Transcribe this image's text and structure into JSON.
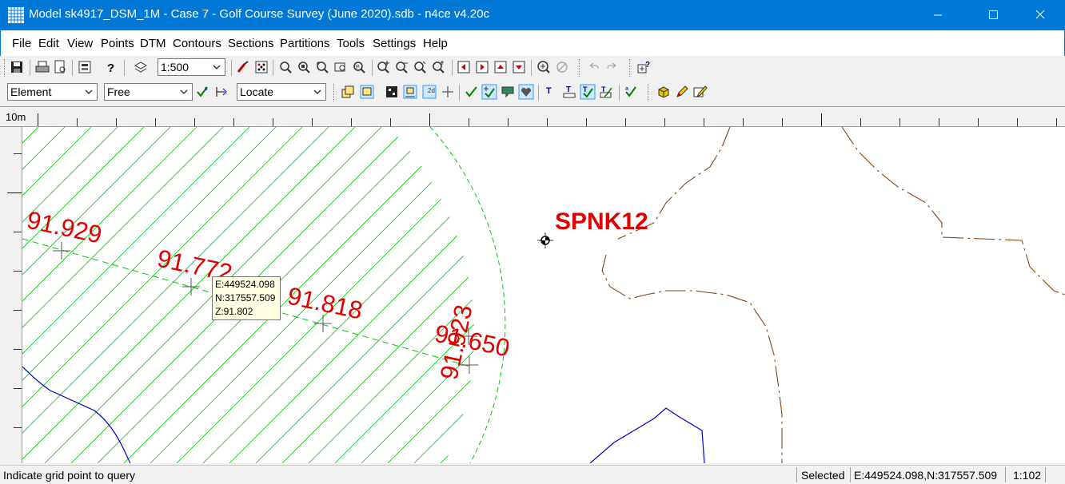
{
  "window": {
    "title": "Model sk4917_DSM_1M - Case 7 - Golf Course Survey (June 2020).sdb - n4ce v4.20c"
  },
  "menu": [
    "File",
    "Edit",
    "View",
    "Points",
    "DTM",
    "Contours",
    "Sections",
    "Partitions",
    "Tools",
    "Settings",
    "Help"
  ],
  "toolbar": {
    "scale": "1:500",
    "select_mode": "Element",
    "snap_mode": "Free",
    "locate_mode": "Locate"
  },
  "ruler": {
    "unit": "10m"
  },
  "canvas": {
    "station_label": "SPNK12",
    "spot_levels": [
      "91.929",
      "91.772",
      "91.818",
      "91.923",
      "91.650"
    ],
    "label_color": "#ff0000",
    "hatch_color": "#00c800",
    "contour_color": "#8b4513",
    "line_color": "#0000c8"
  },
  "tooltip": {
    "e": "E:449524.098",
    "n": "N:317557.509",
    "z": "Z:91.802"
  },
  "status": {
    "message": "Indicate grid point to query",
    "state": "Selected",
    "coords": "E:449524.098,N:317557.509",
    "scale": "1:102"
  }
}
